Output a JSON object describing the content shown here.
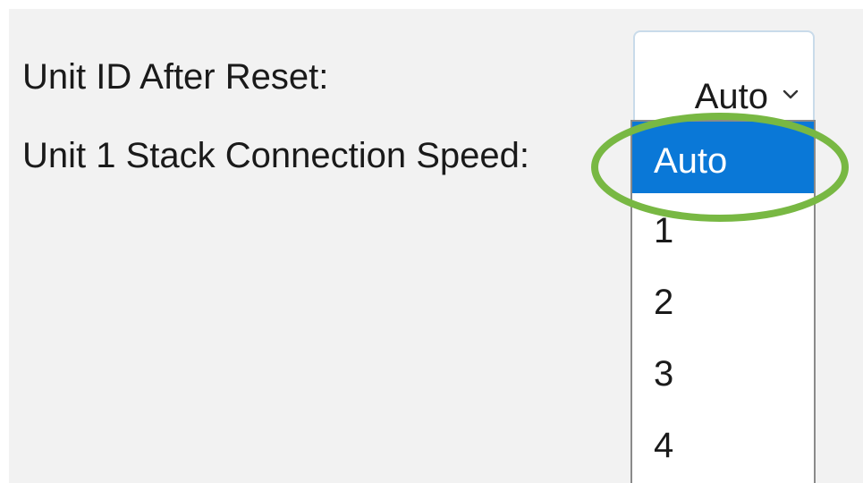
{
  "form": {
    "unit_id_label": "Unit ID After Reset:",
    "speed_label": "Unit 1 Stack Connection Speed:"
  },
  "select": {
    "value": "Auto",
    "icon": "chevron-down-icon"
  },
  "dropdown": {
    "options": [
      "Auto",
      "1",
      "2",
      "3",
      "4"
    ],
    "selected_index": 0
  },
  "colors": {
    "selected_option_bg": "#0a78d7",
    "highlight_ring": "#78b843",
    "panel_bg": "#f2f2f2"
  }
}
